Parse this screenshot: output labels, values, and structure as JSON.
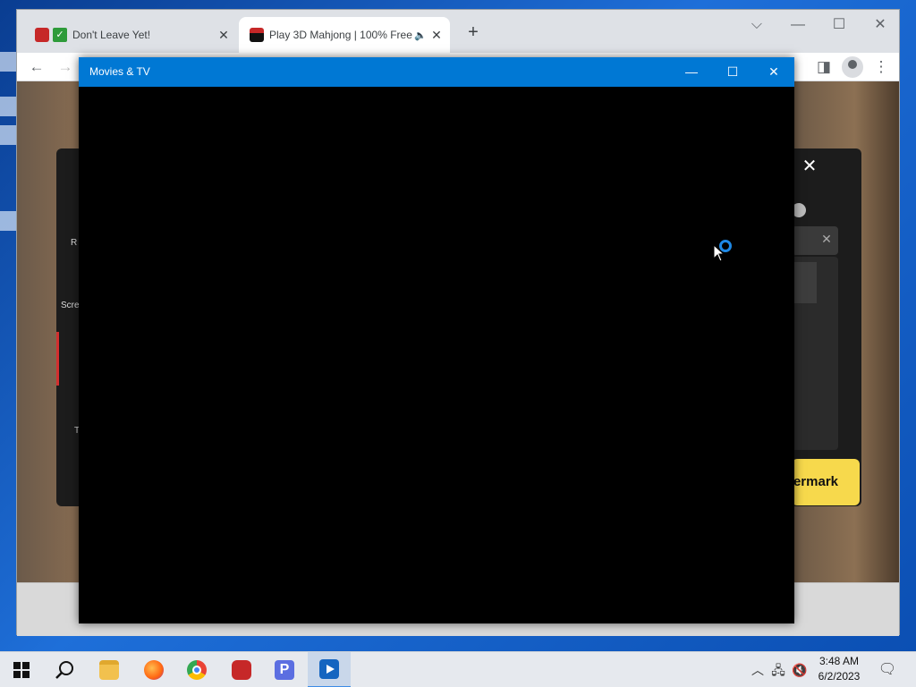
{
  "browser": {
    "tabs": [
      {
        "title": "Don't Leave Yet!",
        "active": false
      },
      {
        "title": "Play 3D Mahjong | 100% Free",
        "active": true
      }
    ],
    "new_tab_label": "+",
    "window_controls": {
      "collapse": "⌵",
      "minimize": "—",
      "maximize": "☐",
      "close": "✕"
    }
  },
  "background_dialog": {
    "left_items": [
      "R",
      "Scre",
      "T"
    ],
    "watermark_button_label": "ermark"
  },
  "movies_window": {
    "title": "Movies & TV",
    "controls": {
      "minimize": "—",
      "maximize": "☐",
      "close": "✕"
    }
  },
  "taskbar": {
    "apps": [
      {
        "name": "start",
        "icon": "windows-icon"
      },
      {
        "name": "search",
        "icon": "search-icon"
      },
      {
        "name": "file-explorer",
        "icon": "folder-icon"
      },
      {
        "name": "firefox",
        "icon": "firefox-icon"
      },
      {
        "name": "chrome",
        "icon": "chrome-icon"
      },
      {
        "name": "screen-recorder",
        "icon": "recorder-icon"
      },
      {
        "name": "p-app",
        "icon": "p-app-icon"
      },
      {
        "name": "movies-tv",
        "icon": "movies-tv-icon",
        "active": true
      }
    ],
    "clock": {
      "time": "3:48 AM",
      "date": "6/2/2023"
    }
  },
  "colors": {
    "accent": "#0078d4",
    "watermark_button": "#f7d94c",
    "spinner": "#1e88e5"
  }
}
